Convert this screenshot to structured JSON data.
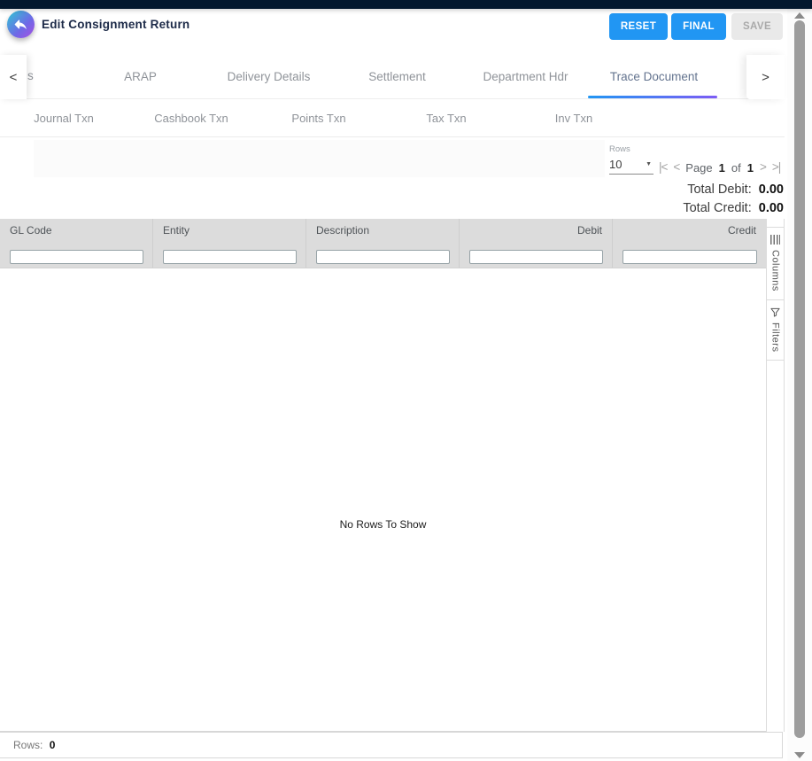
{
  "colors": {
    "topbar_navy": "#03182e",
    "accent_blue": "#2196f3",
    "underline_gradient": [
      "#2196f3",
      "#7d5cf5"
    ],
    "back_button_gradient": [
      "#2fc8d4",
      "#a84fe3"
    ],
    "grid_header_bg": "#dcdcdc",
    "disabled_button_bg": "#e9e9e9"
  },
  "header": {
    "title": "Edit Consignment Return",
    "buttons": {
      "reset": "RESET",
      "final": "FINAL",
      "save": "SAVE"
    }
  },
  "tabs": {
    "clipped_fragment": "s",
    "items": [
      "ARAP",
      "Delivery Details",
      "Settlement",
      "Department Hdr",
      "Trace Document"
    ],
    "active": "Trace Document"
  },
  "subtabs": [
    "Journal Txn",
    "Cashbook Txn",
    "Points Txn",
    "Tax Txn",
    "Inv Txn"
  ],
  "toolbar": {
    "rows_label": "Rows",
    "rows_value": "10",
    "page_label": "Page",
    "page_current": "1",
    "of_label": "of",
    "page_total": "1"
  },
  "totals": {
    "debit_label": "Total Debit:",
    "debit_value": "0.00",
    "credit_label": "Total Credit:",
    "credit_value": "0.00"
  },
  "grid": {
    "columns": [
      "GL Code",
      "Entity",
      "Description",
      "Debit",
      "Credit"
    ],
    "empty_message": "No Rows To Show",
    "status_label": "Rows:",
    "status_value": "0"
  },
  "side_panel": {
    "tabs": [
      "Columns",
      "Filters"
    ]
  },
  "icons": {
    "chevron_left": "<",
    "chevron_right": ">",
    "first_page": "|<",
    "prev_page": "<",
    "next_page": ">",
    "last_page": ">|",
    "dropdown_caret": "▼"
  }
}
